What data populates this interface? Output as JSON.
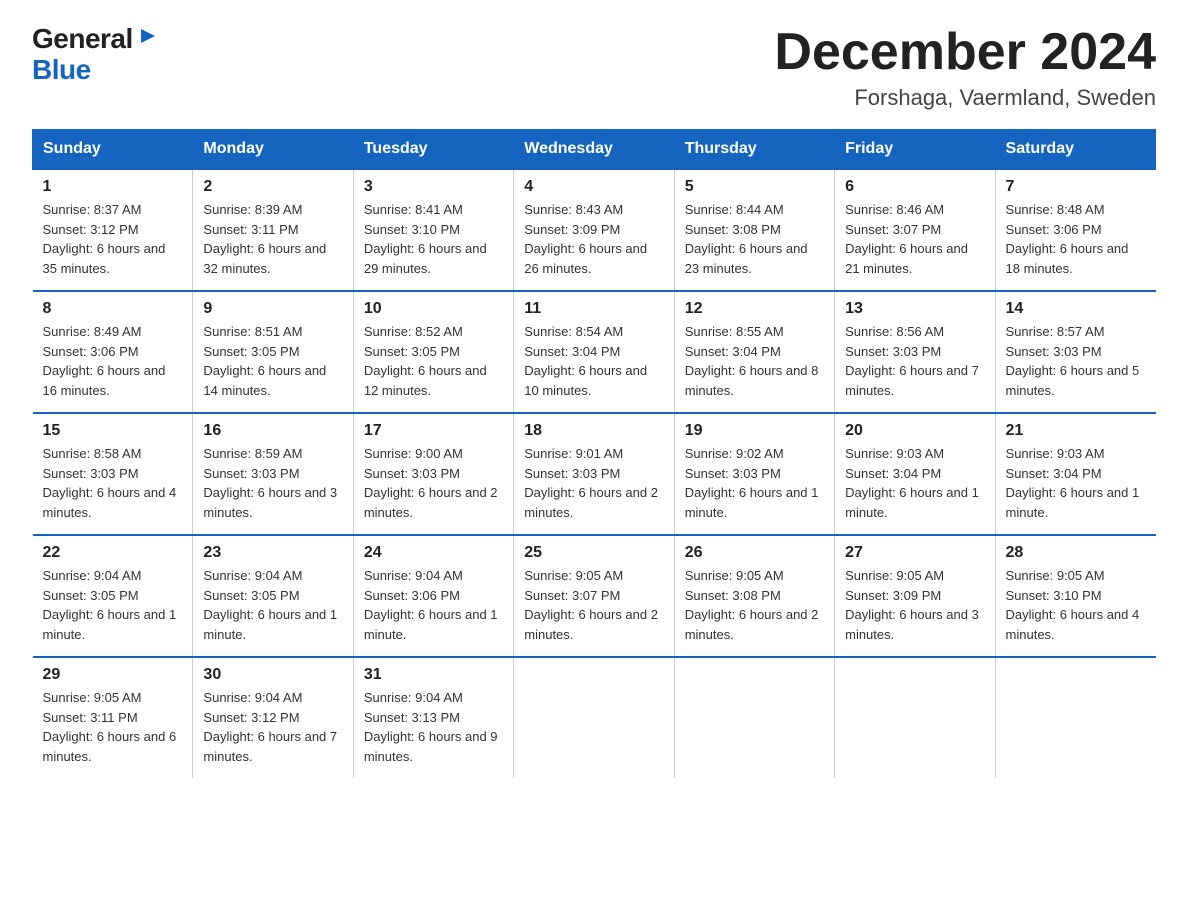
{
  "logo": {
    "general": "General",
    "blue": "Blue"
  },
  "title": "December 2024",
  "subtitle": "Forshaga, Vaermland, Sweden",
  "headers": [
    "Sunday",
    "Monday",
    "Tuesday",
    "Wednesday",
    "Thursday",
    "Friday",
    "Saturday"
  ],
  "weeks": [
    [
      {
        "day": "1",
        "sunrise": "8:37 AM",
        "sunset": "3:12 PM",
        "daylight": "6 hours and 35 minutes."
      },
      {
        "day": "2",
        "sunrise": "8:39 AM",
        "sunset": "3:11 PM",
        "daylight": "6 hours and 32 minutes."
      },
      {
        "day": "3",
        "sunrise": "8:41 AM",
        "sunset": "3:10 PM",
        "daylight": "6 hours and 29 minutes."
      },
      {
        "day": "4",
        "sunrise": "8:43 AM",
        "sunset": "3:09 PM",
        "daylight": "6 hours and 26 minutes."
      },
      {
        "day": "5",
        "sunrise": "8:44 AM",
        "sunset": "3:08 PM",
        "daylight": "6 hours and 23 minutes."
      },
      {
        "day": "6",
        "sunrise": "8:46 AM",
        "sunset": "3:07 PM",
        "daylight": "6 hours and 21 minutes."
      },
      {
        "day": "7",
        "sunrise": "8:48 AM",
        "sunset": "3:06 PM",
        "daylight": "6 hours and 18 minutes."
      }
    ],
    [
      {
        "day": "8",
        "sunrise": "8:49 AM",
        "sunset": "3:06 PM",
        "daylight": "6 hours and 16 minutes."
      },
      {
        "day": "9",
        "sunrise": "8:51 AM",
        "sunset": "3:05 PM",
        "daylight": "6 hours and 14 minutes."
      },
      {
        "day": "10",
        "sunrise": "8:52 AM",
        "sunset": "3:05 PM",
        "daylight": "6 hours and 12 minutes."
      },
      {
        "day": "11",
        "sunrise": "8:54 AM",
        "sunset": "3:04 PM",
        "daylight": "6 hours and 10 minutes."
      },
      {
        "day": "12",
        "sunrise": "8:55 AM",
        "sunset": "3:04 PM",
        "daylight": "6 hours and 8 minutes."
      },
      {
        "day": "13",
        "sunrise": "8:56 AM",
        "sunset": "3:03 PM",
        "daylight": "6 hours and 7 minutes."
      },
      {
        "day": "14",
        "sunrise": "8:57 AM",
        "sunset": "3:03 PM",
        "daylight": "6 hours and 5 minutes."
      }
    ],
    [
      {
        "day": "15",
        "sunrise": "8:58 AM",
        "sunset": "3:03 PM",
        "daylight": "6 hours and 4 minutes."
      },
      {
        "day": "16",
        "sunrise": "8:59 AM",
        "sunset": "3:03 PM",
        "daylight": "6 hours and 3 minutes."
      },
      {
        "day": "17",
        "sunrise": "9:00 AM",
        "sunset": "3:03 PM",
        "daylight": "6 hours and 2 minutes."
      },
      {
        "day": "18",
        "sunrise": "9:01 AM",
        "sunset": "3:03 PM",
        "daylight": "6 hours and 2 minutes."
      },
      {
        "day": "19",
        "sunrise": "9:02 AM",
        "sunset": "3:03 PM",
        "daylight": "6 hours and 1 minute."
      },
      {
        "day": "20",
        "sunrise": "9:03 AM",
        "sunset": "3:04 PM",
        "daylight": "6 hours and 1 minute."
      },
      {
        "day": "21",
        "sunrise": "9:03 AM",
        "sunset": "3:04 PM",
        "daylight": "6 hours and 1 minute."
      }
    ],
    [
      {
        "day": "22",
        "sunrise": "9:04 AM",
        "sunset": "3:05 PM",
        "daylight": "6 hours and 1 minute."
      },
      {
        "day": "23",
        "sunrise": "9:04 AM",
        "sunset": "3:05 PM",
        "daylight": "6 hours and 1 minute."
      },
      {
        "day": "24",
        "sunrise": "9:04 AM",
        "sunset": "3:06 PM",
        "daylight": "6 hours and 1 minute."
      },
      {
        "day": "25",
        "sunrise": "9:05 AM",
        "sunset": "3:07 PM",
        "daylight": "6 hours and 2 minutes."
      },
      {
        "day": "26",
        "sunrise": "9:05 AM",
        "sunset": "3:08 PM",
        "daylight": "6 hours and 2 minutes."
      },
      {
        "day": "27",
        "sunrise": "9:05 AM",
        "sunset": "3:09 PM",
        "daylight": "6 hours and 3 minutes."
      },
      {
        "day": "28",
        "sunrise": "9:05 AM",
        "sunset": "3:10 PM",
        "daylight": "6 hours and 4 minutes."
      }
    ],
    [
      {
        "day": "29",
        "sunrise": "9:05 AM",
        "sunset": "3:11 PM",
        "daylight": "6 hours and 6 minutes."
      },
      {
        "day": "30",
        "sunrise": "9:04 AM",
        "sunset": "3:12 PM",
        "daylight": "6 hours and 7 minutes."
      },
      {
        "day": "31",
        "sunrise": "9:04 AM",
        "sunset": "3:13 PM",
        "daylight": "6 hours and 9 minutes."
      },
      null,
      null,
      null,
      null
    ]
  ]
}
